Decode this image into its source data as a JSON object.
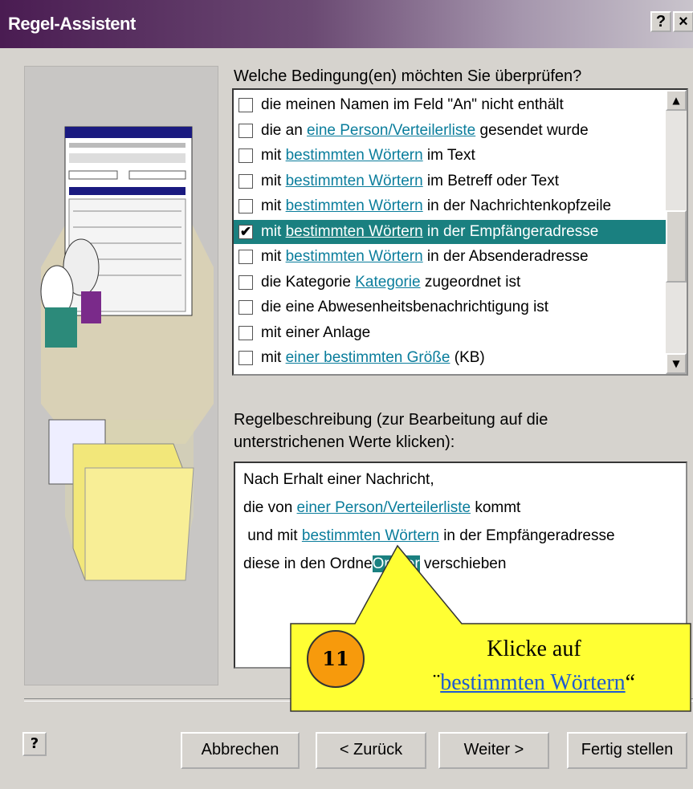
{
  "window": {
    "title": "Regel-Assistent",
    "help_btn": "?",
    "close_btn": "×"
  },
  "conditions": {
    "heading": "Welche Bedingung(en) möchten Sie überprüfen?",
    "items": [
      {
        "checked": false,
        "pre": "die meinen Namen im Feld \"An\" nicht enthält",
        "link": "",
        "post": ""
      },
      {
        "checked": false,
        "pre": "die an ",
        "link": "eine Person/Verteilerliste",
        "post": " gesendet wurde"
      },
      {
        "checked": false,
        "pre": "mit ",
        "link": "bestimmten Wörtern",
        "post": " im Text"
      },
      {
        "checked": false,
        "pre": "mit ",
        "link": "bestimmten Wörtern",
        "post": " im Betreff oder Text"
      },
      {
        "checked": false,
        "pre": "mit ",
        "link": "bestimmten Wörtern",
        "post": " in der Nachrichtenkopfzeile"
      },
      {
        "checked": true,
        "pre": "mit ",
        "link": "bestimmten Wörtern",
        "post": " in der Empfängeradresse"
      },
      {
        "checked": false,
        "pre": "mit ",
        "link": "bestimmten Wörtern",
        "post": " in der Absenderadresse"
      },
      {
        "checked": false,
        "pre": "die Kategorie ",
        "link": "Kategorie",
        "post": " zugeordnet ist"
      },
      {
        "checked": false,
        "pre": "die eine Abwesenheitsbenachrichtigung ist",
        "link": "",
        "post": ""
      },
      {
        "checked": false,
        "pre": "mit einer Anlage",
        "link": "",
        "post": ""
      },
      {
        "checked": false,
        "pre": "mit ",
        "link": "einer bestimmten Größe",
        "post": " (KB)"
      }
    ]
  },
  "description": {
    "heading_line1": "Regelbeschreibung (zur Bearbeitung auf die",
    "heading_line2": "unterstrichenen Werte klicken):",
    "line1": "Nach Erhalt einer Nachricht,",
    "line2_pre": "die von ",
    "line2_link": "einer Person/Verteilerliste",
    "line2_post": " kommt",
    "line3_pre": " und mit ",
    "line3_link": "bestimmten Wörtern",
    "line3_post": " in der Empfängeradresse",
    "line4_pre": "diese in den Ordne",
    "line4_highlight": "Ordner",
    "line4_post": " verschieben"
  },
  "buttons": {
    "cancel": "Abbrechen",
    "back": "< Zurück",
    "next": "Weiter >",
    "finish": "Fertig stellen",
    "help": "?"
  },
  "callout": {
    "step_number": "11",
    "text_line1": "Klicke auf",
    "open_quote": "¨",
    "link_text": "bestimmten Wörtern",
    "close_quote": "“",
    "fill_color": "#ffff33"
  }
}
